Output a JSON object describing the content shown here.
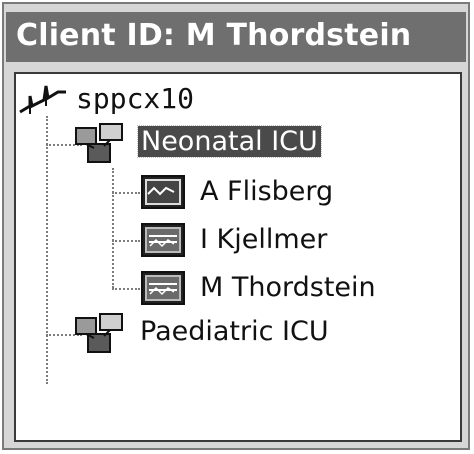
{
  "window": {
    "title": "Client ID: M Thordstein"
  },
  "tree": {
    "root": {
      "label": "sppcx10",
      "icon": "network-icon"
    },
    "units": [
      {
        "label": "Neonatal ICU",
        "icon": "unit-group-icon",
        "selected": true,
        "patients": [
          {
            "label": "A Flisberg",
            "icon": "monitor-icon"
          },
          {
            "label": "I Kjellmer",
            "icon": "monitor-icon"
          },
          {
            "label": "M Thordstein",
            "icon": "monitor-icon"
          }
        ]
      },
      {
        "label": "Paediatric ICU",
        "icon": "unit-group-icon",
        "selected": false
      }
    ]
  }
}
